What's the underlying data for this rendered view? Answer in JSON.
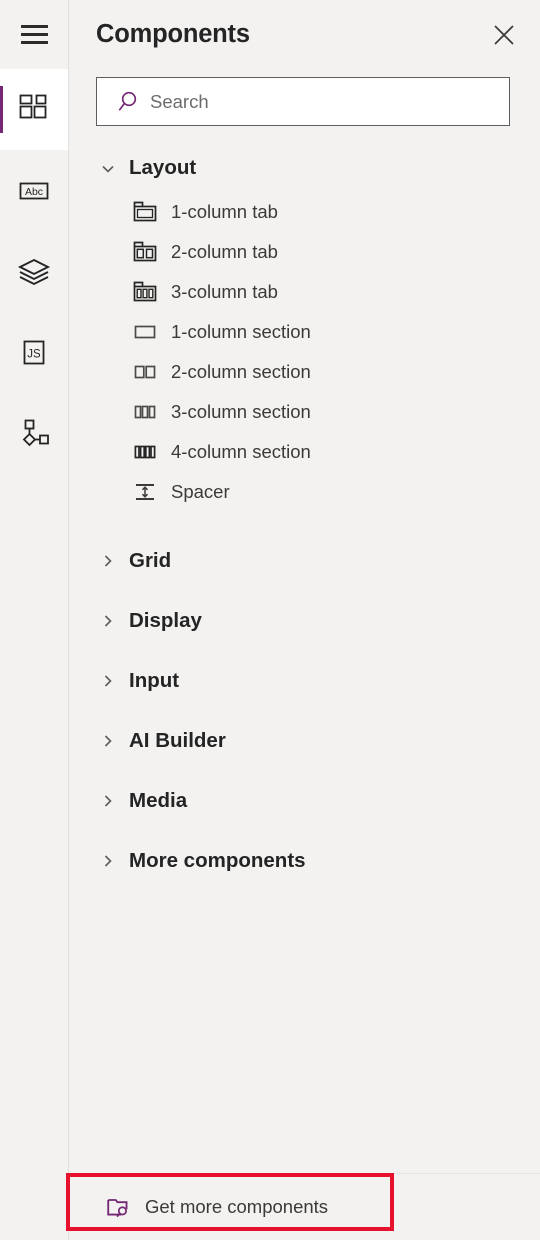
{
  "rail": {
    "menu_button": {
      "label": "Menu",
      "icon": "hamburger-icon"
    },
    "items": [
      {
        "id": "components",
        "label": "Components",
        "icon": "components-icon",
        "selected": true
      },
      {
        "id": "text",
        "label": "Text",
        "icon": "abc-text-icon",
        "selected": false
      },
      {
        "id": "layers",
        "label": "Layers",
        "icon": "layers-icon",
        "selected": false
      },
      {
        "id": "javascript",
        "label": "JavaScript",
        "icon": "js-icon",
        "selected": false
      },
      {
        "id": "tree",
        "label": "Tree view",
        "icon": "node-tree-icon",
        "selected": false
      }
    ]
  },
  "panel": {
    "title": "Components",
    "close_label": "Close",
    "close_icon": "close-icon"
  },
  "search": {
    "value": "",
    "placeholder": "Search",
    "icon": "search-icon"
  },
  "tree": {
    "groups": [
      {
        "label": "Layout",
        "expanded": true,
        "chevron_icon": "chevron-down-icon",
        "items": [
          {
            "label": "1-column tab",
            "icon": "tab-1-column-icon"
          },
          {
            "label": "2-column tab",
            "icon": "tab-2-column-icon"
          },
          {
            "label": "3-column tab",
            "icon": "tab-3-column-icon"
          },
          {
            "label": "1-column section",
            "icon": "section-1-column-icon"
          },
          {
            "label": "2-column section",
            "icon": "section-2-column-icon"
          },
          {
            "label": "3-column section",
            "icon": "section-3-column-icon"
          },
          {
            "label": "4-column section",
            "icon": "section-4-column-icon"
          },
          {
            "label": "Spacer",
            "icon": "spacer-icon"
          }
        ]
      },
      {
        "label": "Grid",
        "expanded": false,
        "chevron_icon": "chevron-right-icon",
        "items": []
      },
      {
        "label": "Display",
        "expanded": false,
        "chevron_icon": "chevron-right-icon",
        "items": []
      },
      {
        "label": "Input",
        "expanded": false,
        "chevron_icon": "chevron-right-icon",
        "items": []
      },
      {
        "label": "AI Builder",
        "expanded": false,
        "chevron_icon": "chevron-right-icon",
        "items": []
      },
      {
        "label": "Media",
        "expanded": false,
        "chevron_icon": "chevron-right-icon",
        "items": []
      },
      {
        "label": "More components",
        "expanded": false,
        "chevron_icon": "chevron-right-icon",
        "items": []
      }
    ]
  },
  "footer": {
    "get_more_label": "Get more components",
    "get_more_icon": "folder-search-icon"
  },
  "annotation": {
    "color": "#e8112d",
    "target": "get-more-components-button"
  },
  "colors": {
    "background": "#f3f2f1",
    "accent_purple": "#742774",
    "text_primary": "#242424",
    "text_secondary": "#3b3a39",
    "border": "#e1dfdd",
    "selected_background": "#ffffff",
    "highlight_red": "#e8112d"
  }
}
